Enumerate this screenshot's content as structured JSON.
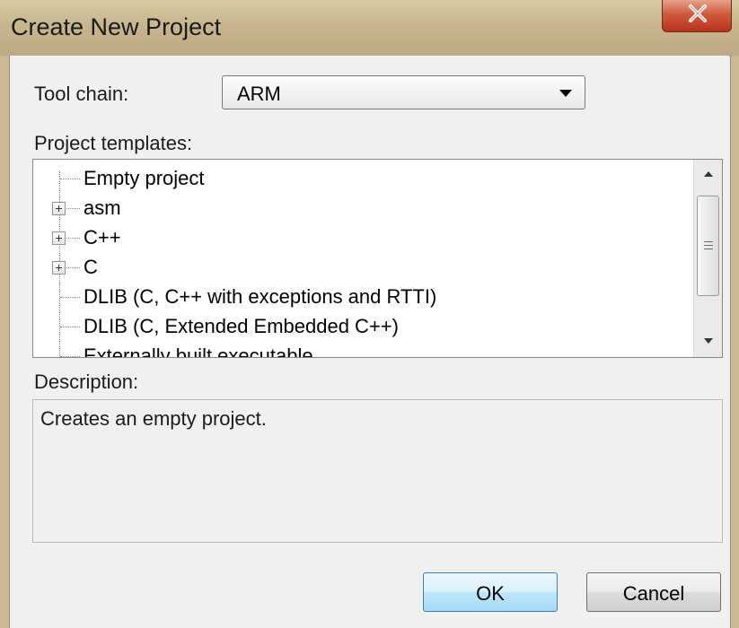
{
  "window": {
    "title": "Create New Project"
  },
  "toolchain": {
    "label": "Tool chain:",
    "value": "ARM"
  },
  "templates": {
    "label": "Project templates:",
    "items": [
      {
        "label": "Empty project",
        "expandable": false
      },
      {
        "label": "asm",
        "expandable": true
      },
      {
        "label": "C++",
        "expandable": true
      },
      {
        "label": "C",
        "expandable": true
      },
      {
        "label": "DLIB (C, C++ with exceptions and RTTI)",
        "expandable": false
      },
      {
        "label": "DLIB (C, Extended Embedded C++)",
        "expandable": false
      },
      {
        "label": "Externally built executable",
        "expandable": false
      }
    ]
  },
  "description": {
    "label": "Description:",
    "text": "Creates an empty project."
  },
  "buttons": {
    "ok": "OK",
    "cancel": "Cancel"
  },
  "colors": {
    "title_bar": "#c9b78f",
    "close_button": "#cf5a3e",
    "default_button": "#bee6fd"
  }
}
